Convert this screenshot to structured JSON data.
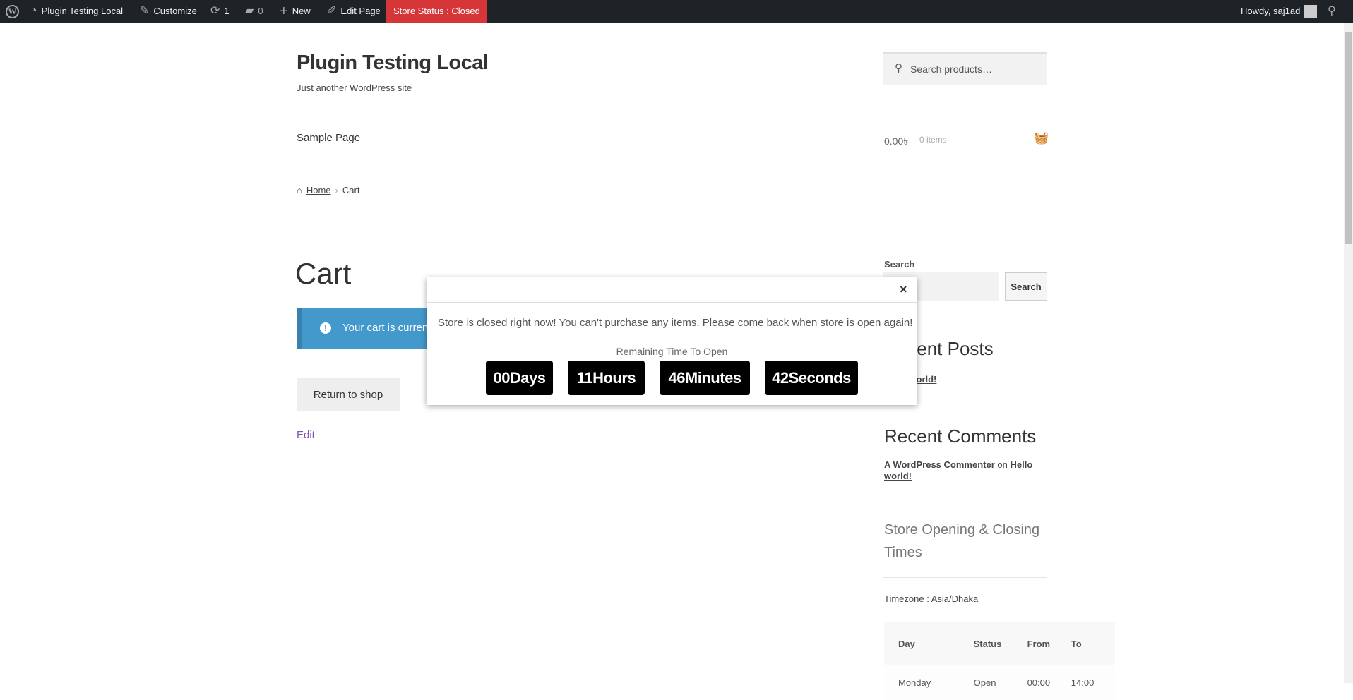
{
  "adminbar": {
    "site": "Plugin Testing Local",
    "customize": "Customize",
    "updates": "1",
    "comments": "0",
    "new": "New",
    "edit_page": "Edit Page",
    "store_status": "Store Status : Closed",
    "howdy": "Howdy, saj1ad",
    "status_color": "#d63638"
  },
  "header": {
    "title": "Plugin Testing Local",
    "tagline": "Just another WordPress site",
    "search_placeholder": "Search products…",
    "nav": [
      "Sample Page"
    ],
    "cart_amount": "0.00৳",
    "cart_items": "0 items"
  },
  "breadcrumb": {
    "home": "Home",
    "current": "Cart"
  },
  "main": {
    "title": "Cart",
    "notice": "Your cart is currently empty.",
    "return_button": "Return to shop",
    "edit": "Edit"
  },
  "modal": {
    "message": "Store is closed right now! You can't purchase any items. Please come back when store is open again!",
    "remaining_label": "Remaining Time To Open",
    "days": "00Days",
    "hours": "11Hours",
    "minutes": "46Minutes",
    "seconds": "42Seconds"
  },
  "sidebar": {
    "search_label": "Search",
    "search_button": "Search",
    "recent_posts_title": "Recent Posts",
    "recent_post": "Hello world!",
    "recent_comments_title": "Recent Comments",
    "comment_author": "A WordPress Commenter",
    "comment_on": "on",
    "comment_post": "Hello world!",
    "hours_title": "Store Opening & Closing Times",
    "timezone": "Timezone : Asia/Dhaka",
    "table_headers": [
      "Day",
      "Status",
      "From",
      "To"
    ],
    "rows": [
      [
        "Monday",
        "Open",
        "00:00",
        "14:00"
      ]
    ]
  }
}
